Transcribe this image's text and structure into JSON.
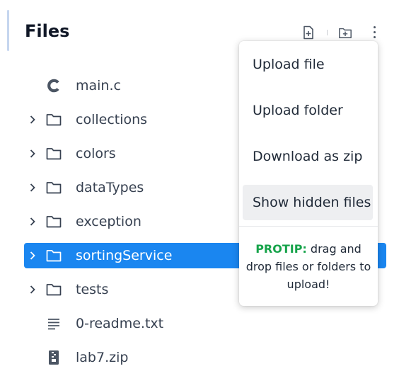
{
  "panel": {
    "title": "Files"
  },
  "header_icons": [
    "new-file-icon",
    "new-folder-icon",
    "more-options-icon"
  ],
  "tree": [
    {
      "label": "main.c",
      "kind": "c-file",
      "icon": "c-language-icon"
    },
    {
      "label": "collections",
      "kind": "folder",
      "icon": "folder-icon"
    },
    {
      "label": "colors",
      "kind": "folder",
      "icon": "folder-icon"
    },
    {
      "label": "dataTypes",
      "kind": "folder",
      "icon": "folder-icon"
    },
    {
      "label": "exception",
      "kind": "folder",
      "icon": "folder-icon"
    },
    {
      "label": "sortingService",
      "kind": "folder",
      "icon": "folder-icon",
      "selected": true
    },
    {
      "label": "tests",
      "kind": "folder",
      "icon": "folder-icon"
    },
    {
      "label": "0-readme.txt",
      "kind": "text-file",
      "icon": "text-file-icon"
    },
    {
      "label": "lab7.zip",
      "kind": "zip-file",
      "icon": "zip-file-icon"
    }
  ],
  "menu": {
    "items": [
      "Upload file",
      "Upload folder",
      "Download as zip",
      "Show hidden files"
    ],
    "protip_label": "PROTIP:",
    "protip_text": " drag and drop files or folders to upload!"
  },
  "colors": {
    "selected": "#1a86f0",
    "protip": "#16a34a",
    "accent_bar": "#c5d6ef"
  }
}
